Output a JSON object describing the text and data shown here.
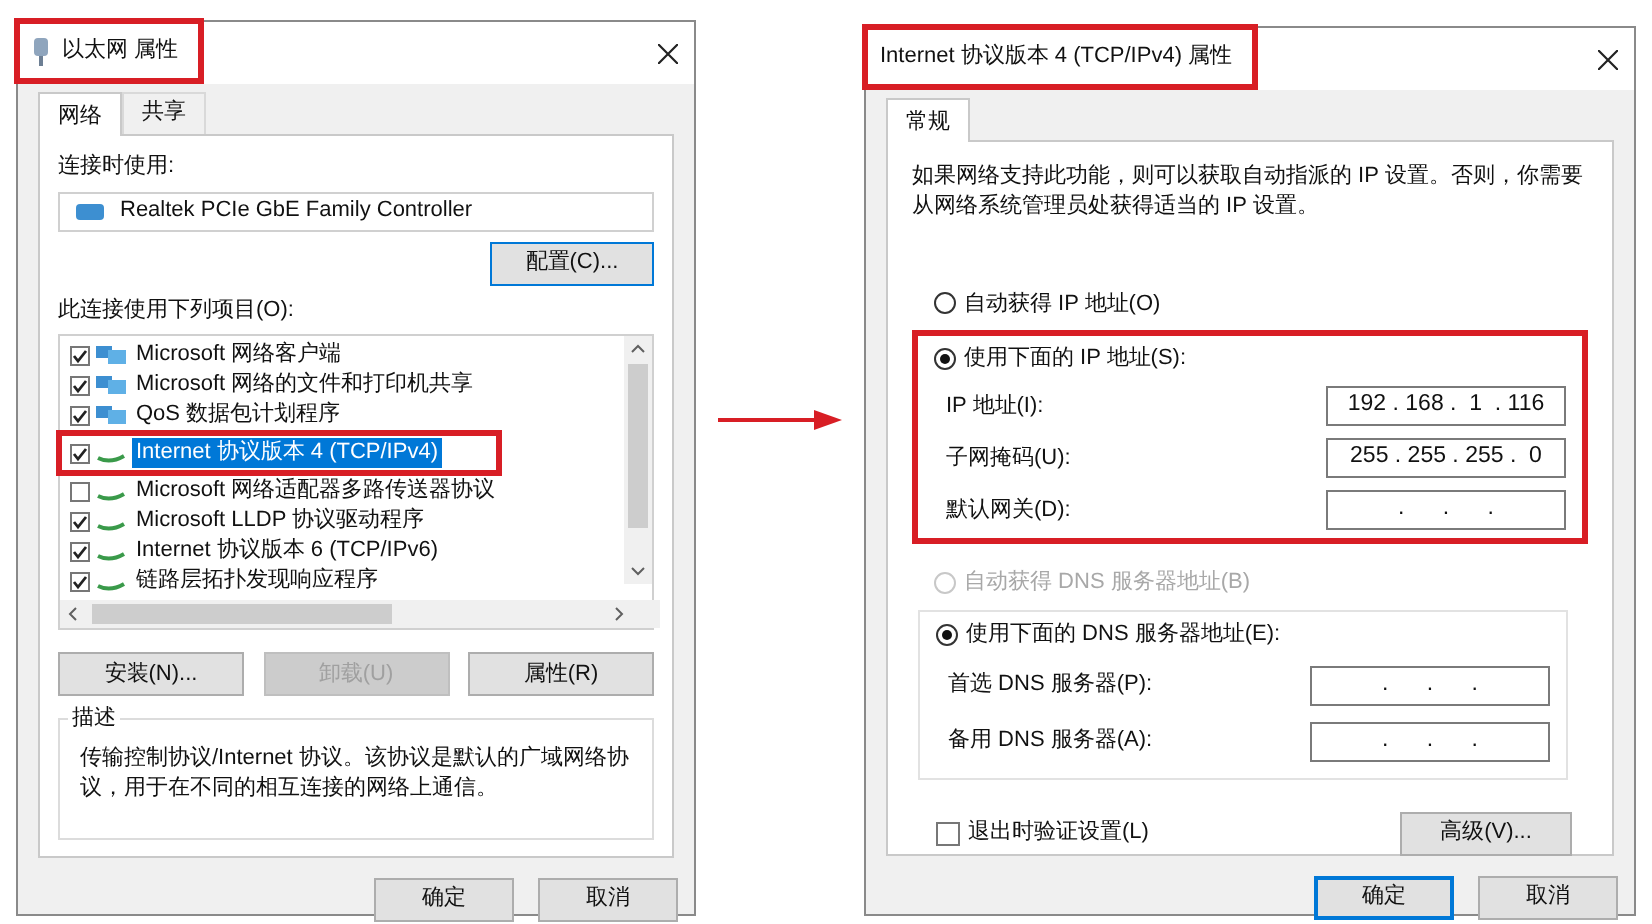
{
  "left_dialog": {
    "title": "以太网 属性",
    "highlighted": true,
    "tabs": [
      {
        "label": "网络",
        "selected": true
      },
      {
        "label": "共享",
        "selected": false
      }
    ],
    "connect_using_label": "连接时使用:",
    "adapter": "Realtek PCIe GbE Family Controller",
    "configure_button": "配置(C)...",
    "items_label": "此连接使用下列项目(O):",
    "items": [
      {
        "label": "Microsoft 网络客户端",
        "checked": true,
        "selected": false,
        "highlighted": false,
        "kind": "network"
      },
      {
        "label": "Microsoft 网络的文件和打印机共享",
        "checked": true,
        "selected": false,
        "highlighted": false,
        "kind": "network"
      },
      {
        "label": "QoS 数据包计划程序",
        "checked": true,
        "selected": false,
        "highlighted": false,
        "kind": "network"
      },
      {
        "label": "Internet 协议版本 4 (TCP/IPv4)",
        "checked": true,
        "selected": true,
        "highlighted": true,
        "kind": "protocol"
      },
      {
        "label": "Microsoft 网络适配器多路传送器协议",
        "checked": false,
        "selected": false,
        "highlighted": false,
        "kind": "protocol"
      },
      {
        "label": "Microsoft LLDP 协议驱动程序",
        "checked": true,
        "selected": false,
        "highlighted": false,
        "kind": "protocol"
      },
      {
        "label": "Internet 协议版本 6 (TCP/IPv6)",
        "checked": true,
        "selected": false,
        "highlighted": false,
        "kind": "protocol"
      },
      {
        "label": "链路层拓扑发现响应程序",
        "checked": true,
        "selected": false,
        "highlighted": false,
        "kind": "protocol"
      }
    ],
    "item_buttons": [
      {
        "label": "安装(N)...",
        "disabled": false
      },
      {
        "label": "卸载(U)",
        "disabled": true
      },
      {
        "label": "属性(R)",
        "disabled": false
      }
    ],
    "description": {
      "legend": "描述",
      "text": "传输控制协议/Internet 协议。该协议是默认的广域网络协议，用于在不同的相互连接的网络上通信。"
    },
    "footer_buttons": [
      {
        "label": "确定",
        "focused": false
      },
      {
        "label": "取消",
        "focused": false
      }
    ]
  },
  "right_dialog": {
    "title": "Internet 协议版本 4 (TCP/IPv4) 属性",
    "highlighted": true,
    "tabs": [
      {
        "label": "常规",
        "selected": true
      }
    ],
    "intro": "如果网络支持此功能，则可以获取自动指派的 IP 设置。否则，你需要从网络系统管理员处获得适当的 IP 设置。",
    "ip_auto": {
      "label": "自动获得 IP 地址(O)",
      "selected": false,
      "disabled": false
    },
    "ip_manual": {
      "label": "使用下面的 IP 地址(S):",
      "selected": true,
      "disabled": false,
      "highlighted": true
    },
    "ip_fields": [
      {
        "label": "IP 地址(I):",
        "value": "192 . 168 .  1  . 116"
      },
      {
        "label": "子网掩码(U):",
        "value": "255 . 255 . 255 .  0"
      },
      {
        "label": "默认网关(D):",
        "value": ".      .      ."
      }
    ],
    "dns_auto": {
      "label": "自动获得 DNS 服务器地址(B)",
      "selected": false,
      "disabled": true
    },
    "dns_manual": {
      "label": "使用下面的 DNS 服务器地址(E):",
      "selected": true,
      "disabled": false
    },
    "dns_fields": [
      {
        "label": "首选 DNS 服务器(P):",
        "value": ".      .      ."
      },
      {
        "label": "备用 DNS 服务器(A):",
        "value": ".      .      ."
      }
    ],
    "validate": {
      "label": "退出时验证设置(L)",
      "checked": false
    },
    "advanced_button": "高级(V)...",
    "footer_buttons": [
      {
        "label": "确定",
        "focused": true
      },
      {
        "label": "取消",
        "focused": false
      }
    ]
  }
}
